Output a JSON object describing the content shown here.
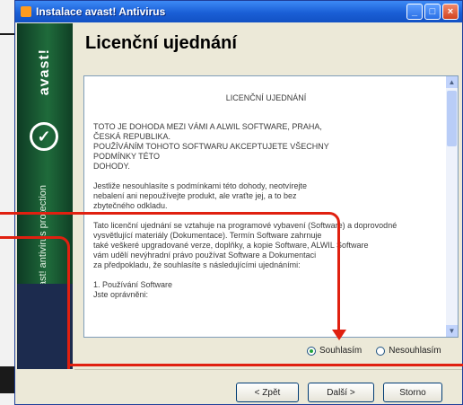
{
  "window": {
    "title": "Instalace avast! Antivirus",
    "buttons": {
      "minimize": "_",
      "maximize": "□",
      "close": "×"
    }
  },
  "sidebar": {
    "brand": "avast!",
    "slogan": "avast! antivirus protection",
    "logo_glyph": "✓"
  },
  "page": {
    "title": "Licenční ujednání"
  },
  "license": {
    "heading": "LICENČNÍ UJEDNÁNÍ",
    "text": "TOTO JE DOHODA MEZI VÁMI A ALWIL SOFTWARE, PRAHA,\nČESKÁ REPUBLIKA.\nPOUŽÍVÁNÍM TOHOTO SOFTWARU AKCEPTUJETE VŠECHNY\nPODMÍNKY TÉTO\nDOHODY.\n\nJestliže nesouhlasíte s podmínkami této dohody, neotvírejte\nnebalení ani nepoužívejte produkt, ale vraťte jej, a to bez\nzbytečného odkladu.\n\nTato licenční ujednání se vztahuje na programové vybavení (Software) a doprovodné\nvysvětlující materiály (Dokumentace). Termín Software zahrnuje\ntaké veškeré upgradované verze, doplňky, a kopie Software, ALWIL Software\nvám udělí nevýhradní právo používat Software a Dokumentaci\nza předpokladu, že souhlasíte s následujícími ujednáními:\n\n1. Používání Software\nJste oprávněni:"
  },
  "options": {
    "agree": "Souhlasím",
    "disagree": "Nesouhlasím",
    "selected": "agree"
  },
  "buttons": {
    "back": "< Zpět",
    "next": "Další >",
    "cancel": "Storno"
  },
  "colors": {
    "annotation": "#e02010",
    "sidebar": "#1f6b3b",
    "titlebar": "#1a5fd6"
  }
}
